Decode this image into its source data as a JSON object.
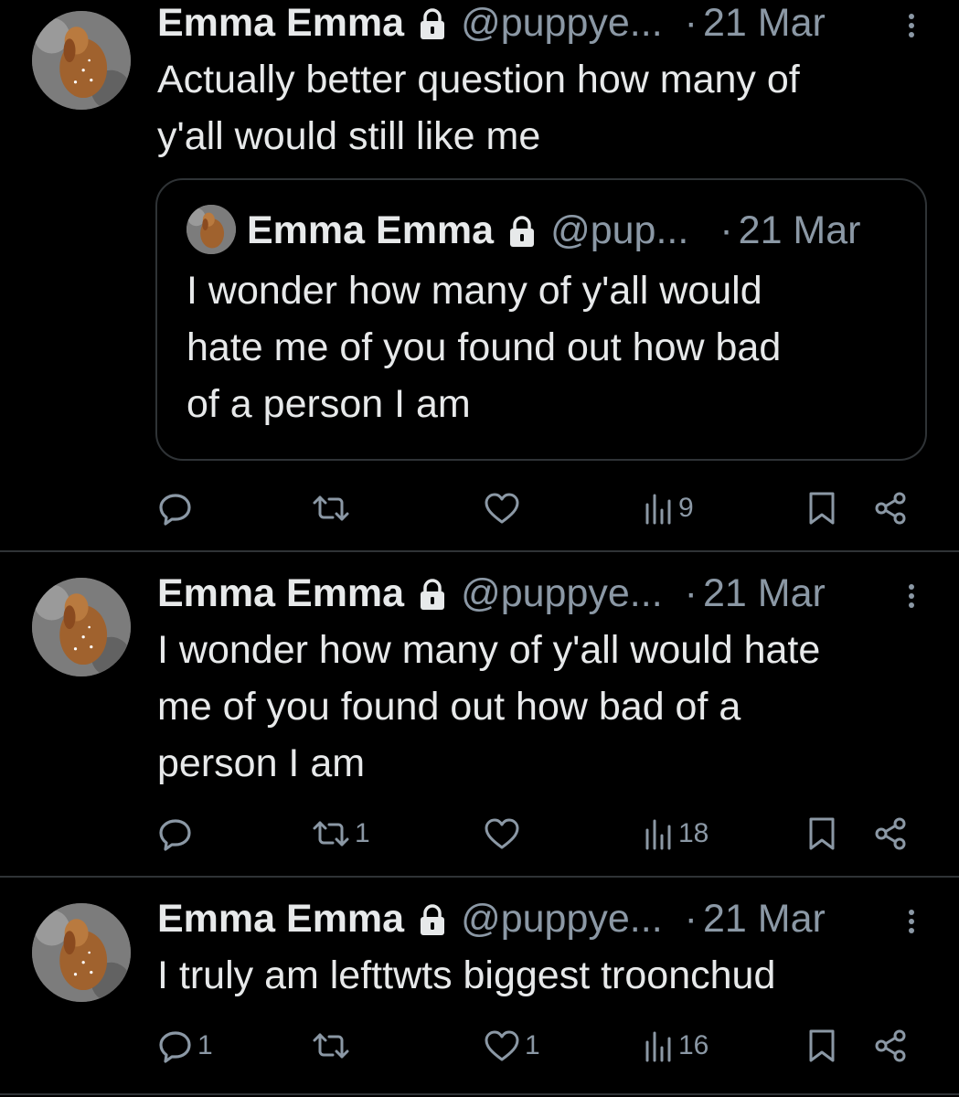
{
  "tweets": [
    {
      "name": "Emma Emma",
      "handle": "@puppye...",
      "date": "21 Mar",
      "text_lines": [
        "Actually better question how many of",
        "y'all would still like me"
      ],
      "quote": {
        "name": "Emma Emma",
        "handle": "@pup...",
        "date": "21 Mar",
        "text_lines": [
          "I wonder how many of y'all would",
          "hate me of you found out how bad",
          "of a person I am"
        ]
      },
      "actions": {
        "reply_count": "",
        "retweet_count": "",
        "like_count": "",
        "views_count": "9"
      }
    },
    {
      "name": "Emma Emma",
      "handle": "@puppye...",
      "date": "21 Mar",
      "text_lines": [
        "I wonder how many of y'all would hate",
        "me of you found out how bad of a",
        "person I am"
      ],
      "actions": {
        "reply_count": "",
        "retweet_count": "1",
        "like_count": "",
        "views_count": "18"
      }
    },
    {
      "name": "Emma Emma",
      "handle": "@puppye...",
      "date": "21 Mar",
      "text_lines": [
        "I truly am lefttwts biggest troonchud"
      ],
      "actions": {
        "reply_count": "1",
        "retweet_count": "",
        "like_count": "1",
        "views_count": "16"
      }
    }
  ],
  "separator": "·",
  "icons": [
    "avatar-image",
    "lock-icon",
    "more-vertical-icon",
    "reply-icon",
    "retweet-icon",
    "like-icon",
    "views-icon",
    "bookmark-icon",
    "share-icon"
  ],
  "colors": {
    "background": "#000000",
    "text": "#e7e9ea",
    "secondary": "#8b98a5",
    "border": "#2f3336"
  }
}
